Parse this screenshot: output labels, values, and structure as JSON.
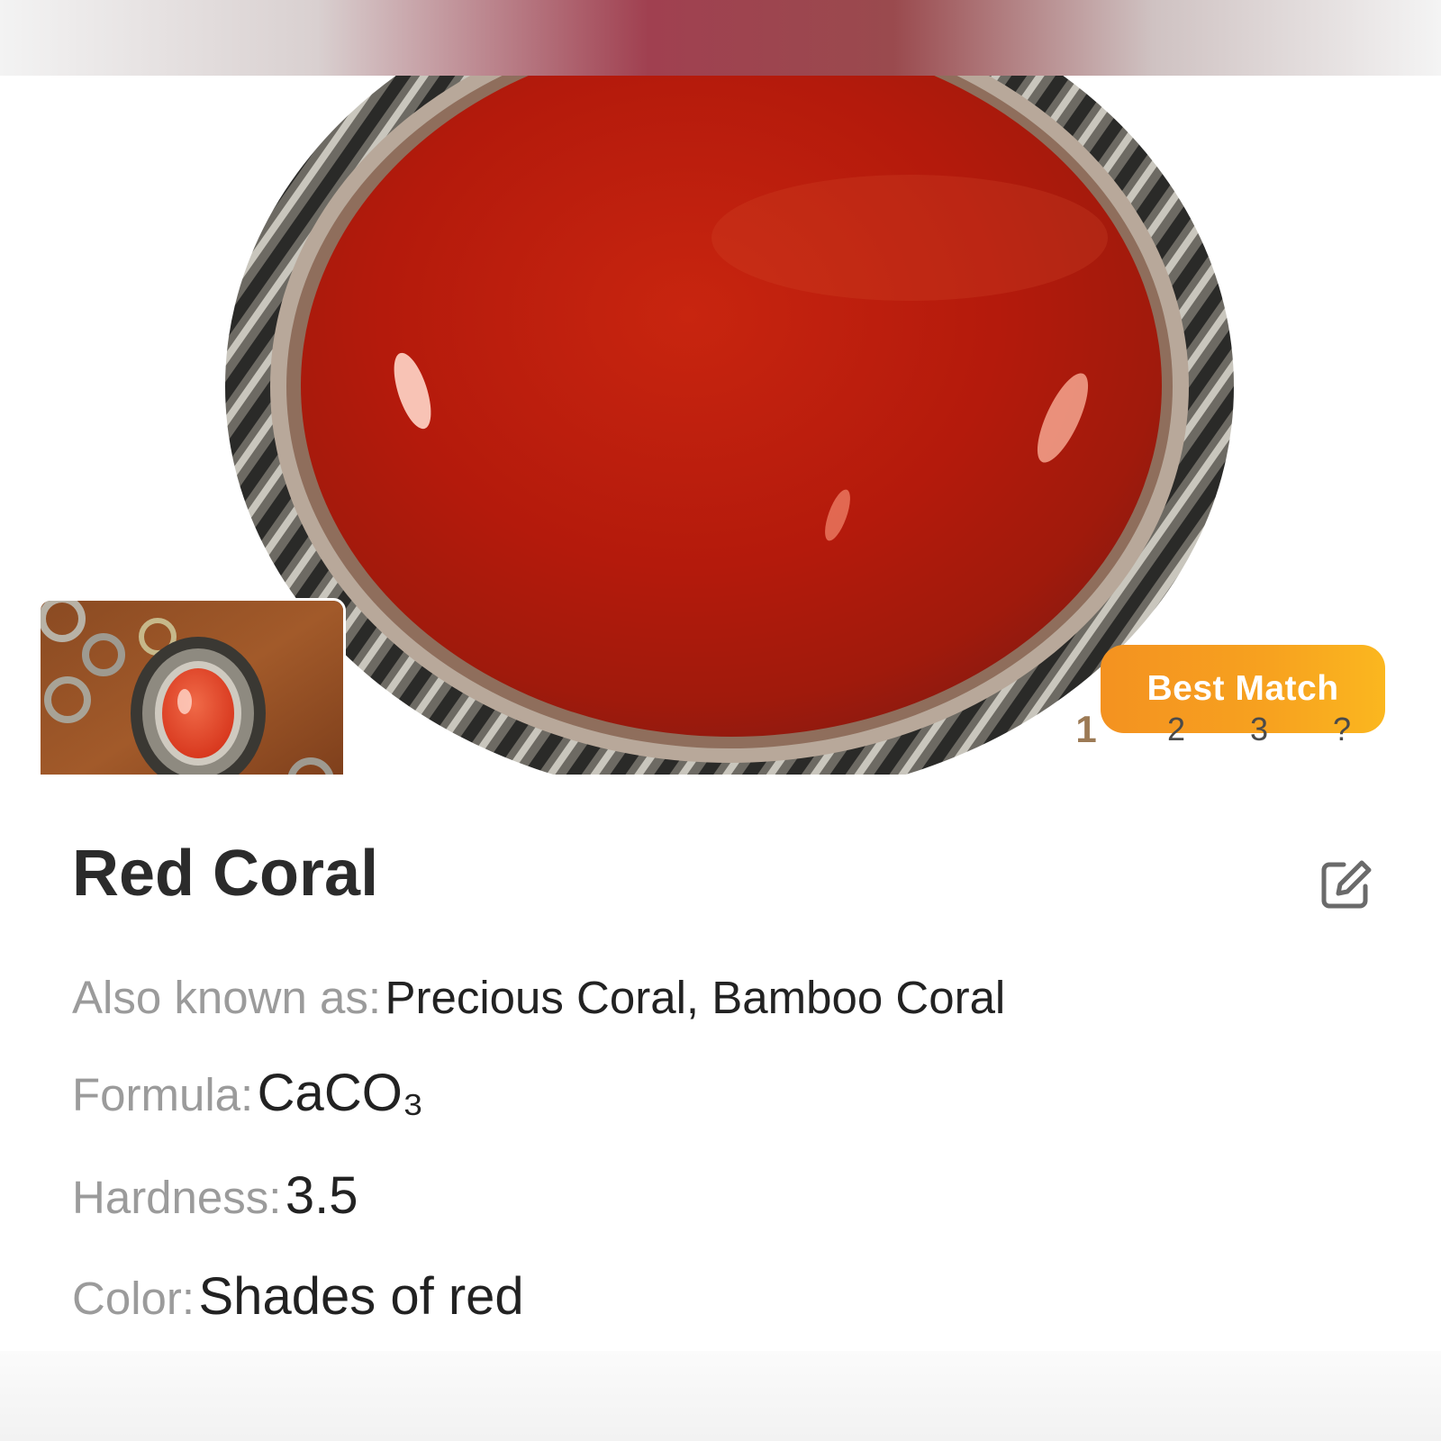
{
  "result": {
    "badge_label": "Best Match",
    "pager": [
      "1",
      "2",
      "3",
      "?"
    ],
    "active_page_index": 0
  },
  "stone": {
    "name": "Red Coral",
    "properties": [
      {
        "label": "Also known as:",
        "value": "Precious Coral, Bamboo Coral"
      },
      {
        "label": "Formula:",
        "value": "CaCO₃"
      },
      {
        "label": "Hardness:",
        "value": "3.5"
      },
      {
        "label": "Color:",
        "value": "Shades of red"
      }
    ]
  },
  "icons": {
    "edit": "edit-icon"
  },
  "colors": {
    "accent": "#f7a21f",
    "stone_red": "#b81c10",
    "active_page": "#9c7a55"
  }
}
